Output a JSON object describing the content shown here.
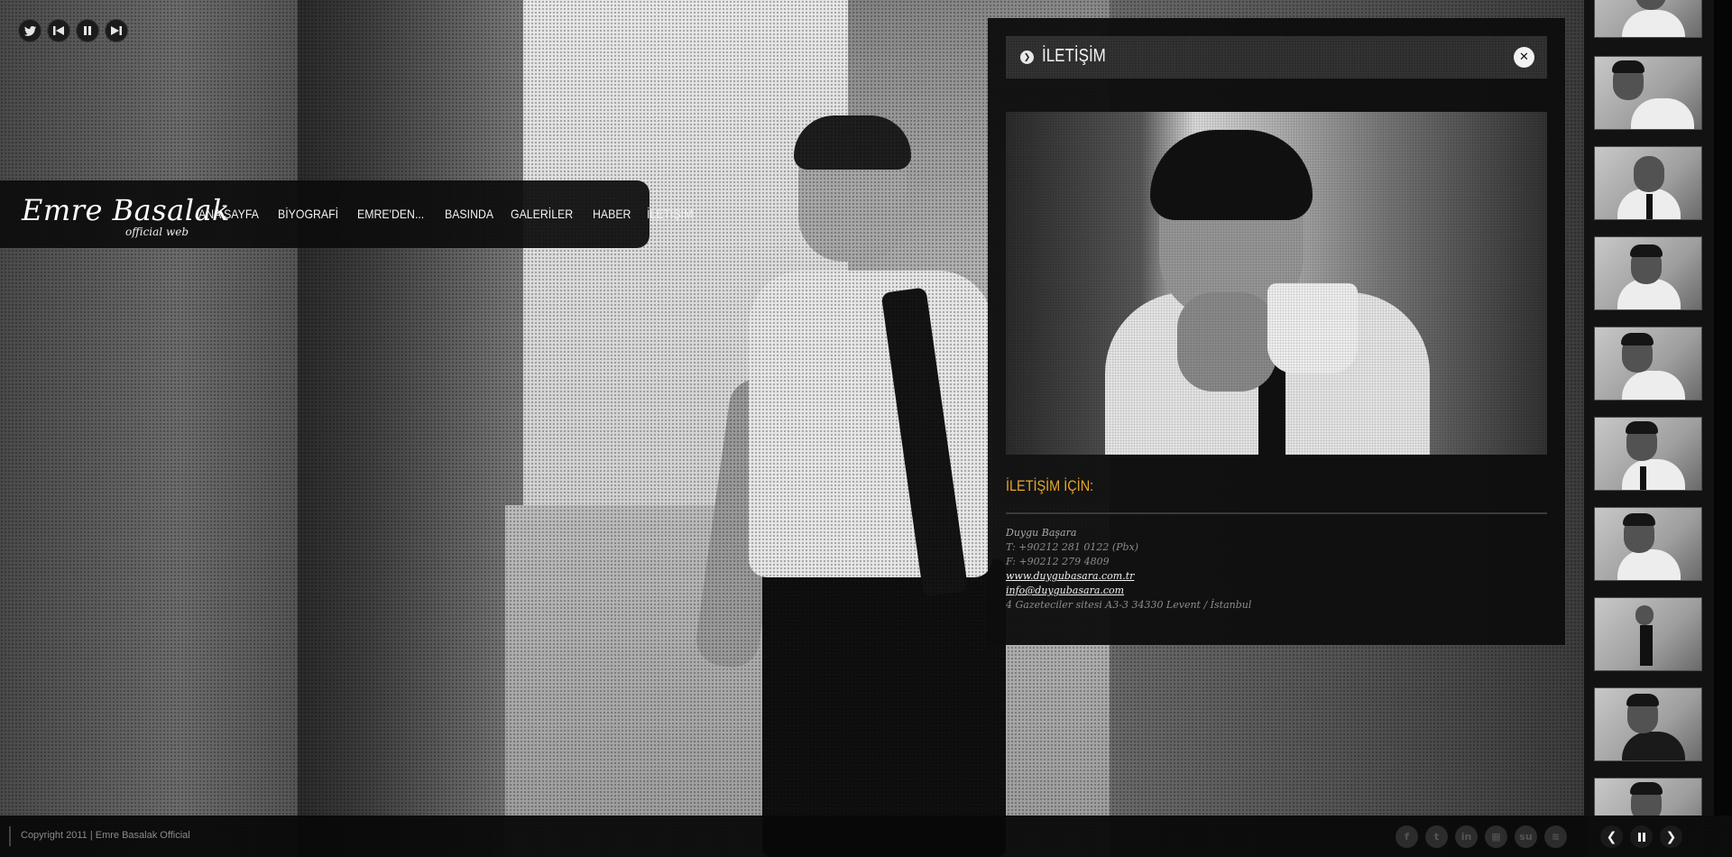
{
  "player": {
    "twitter_icon": "twitter-bird-icon",
    "prev_icon": "skip-previous-icon",
    "pause_icon": "pause-icon",
    "next_icon": "skip-next-icon"
  },
  "brand": {
    "logo_text": "Emre Basalak",
    "logo_subtext": "official web"
  },
  "nav": {
    "items": [
      {
        "label": "ANA SAYFA"
      },
      {
        "label": "BİYOGRAFİ"
      },
      {
        "label": "EMRE'DEN..."
      },
      {
        "label": "BASINDA"
      },
      {
        "label": "GALERİLER"
      },
      {
        "label": "HABER"
      },
      {
        "label": "İLETİŞİM"
      }
    ]
  },
  "panel": {
    "title": "İLETİŞİM",
    "close_icon": "close-icon",
    "contact_heading": "İLETİŞİM İÇİN:",
    "contact": {
      "name": "Duygu Başara",
      "phone": "T: +90212 281 0122 (Pbx)",
      "fax": "F: +90212 279 4809",
      "website": "www.duygubasara.com.tr",
      "email": "info@duygubasara.com",
      "address": "4 Gazeteciler sitesi A3-3 34330 Levent / İstanbul"
    }
  },
  "footer": {
    "copyright": "Copyright 2011 | Emre Basalak Official",
    "social": [
      "facebook-icon",
      "twitter-icon",
      "linkedin-icon",
      "delicious-icon",
      "stumbleupon-icon",
      "rss-icon"
    ],
    "slideshow": {
      "prev_icon": "chevron-left-icon",
      "pause_icon": "pause-icon",
      "next_icon": "chevron-right-icon"
    }
  },
  "colors": {
    "accent": "#e8a72c",
    "panel_bg": "#0e0e0e",
    "text_light": "#f2f2f2"
  }
}
